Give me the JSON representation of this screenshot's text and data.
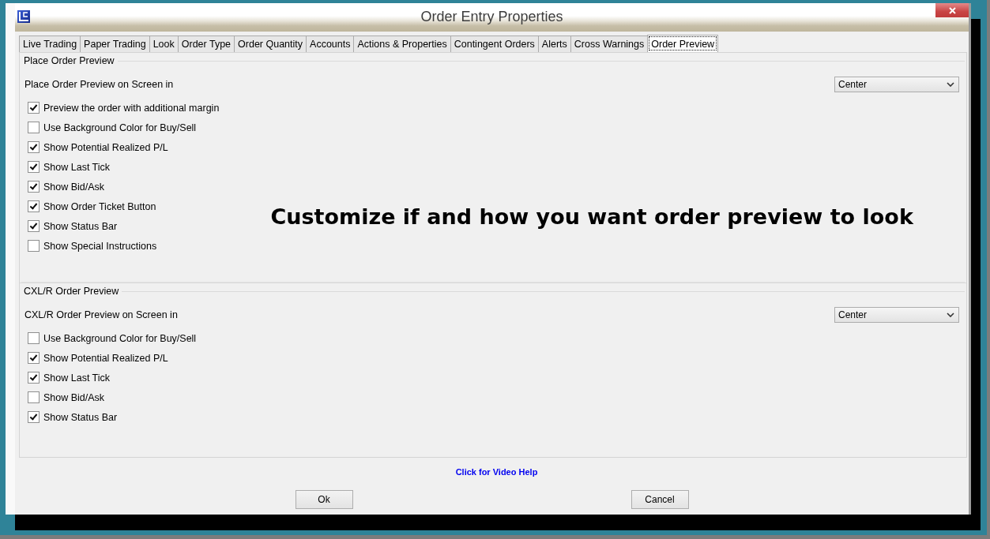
{
  "window": {
    "title": "Order Entry Properties"
  },
  "tabs": [
    {
      "label": "Live Trading",
      "selected": false
    },
    {
      "label": "Paper Trading",
      "selected": false
    },
    {
      "label": "Look",
      "selected": false
    },
    {
      "label": "Order Type",
      "selected": false
    },
    {
      "label": "Order Quantity",
      "selected": false
    },
    {
      "label": "Accounts",
      "selected": false
    },
    {
      "label": "Actions & Properties",
      "selected": false
    },
    {
      "label": "Contingent Orders",
      "selected": false
    },
    {
      "label": "Alerts",
      "selected": false
    },
    {
      "label": "Cross Warnings",
      "selected": false
    },
    {
      "label": "Order Preview",
      "selected": true
    }
  ],
  "sections": [
    {
      "title": "Place Order Preview",
      "position_label": "Place Order Preview on Screen in",
      "position_value": "Center",
      "options": [
        {
          "label": "Preview the order with additional margin",
          "checked": true
        },
        {
          "label": "Use Background Color for Buy/Sell",
          "checked": false
        },
        {
          "label": "Show Potential Realized P/L",
          "checked": true
        },
        {
          "label": "Show Last Tick",
          "checked": true
        },
        {
          "label": "Show Bid/Ask",
          "checked": true
        },
        {
          "label": "Show Order Ticket Button",
          "checked": true
        },
        {
          "label": "Show Status Bar",
          "checked": true
        },
        {
          "label": "Show Special Instructions",
          "checked": false
        }
      ],
      "callout": "Customize if and how you want order preview to look"
    },
    {
      "title": "CXL/R Order Preview",
      "position_label": "CXL/R Order Preview on Screen in",
      "position_value": "Center",
      "options": [
        {
          "label": "Use Background Color for Buy/Sell",
          "checked": false
        },
        {
          "label": "Show Potential Realized P/L",
          "checked": true
        },
        {
          "label": "Show Last Tick",
          "checked": true
        },
        {
          "label": "Show Bid/Ask",
          "checked": false
        },
        {
          "label": "Show Status Bar",
          "checked": true
        }
      ]
    }
  ],
  "help_link": "Click for Video Help",
  "buttons": [
    "Ok",
    "Cancel"
  ]
}
